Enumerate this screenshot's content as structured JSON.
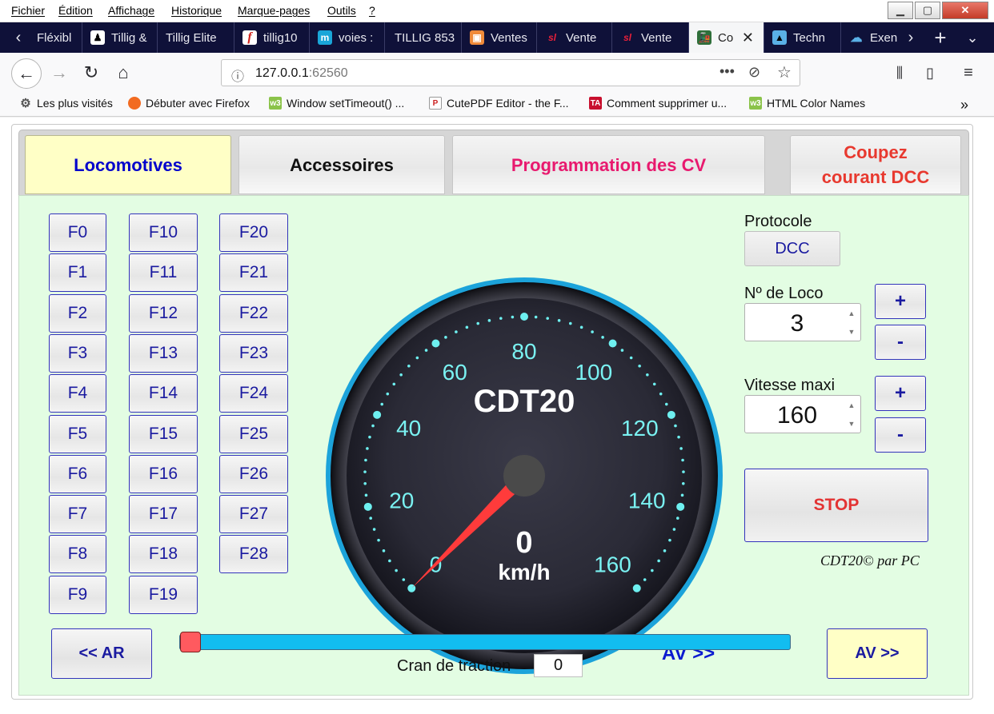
{
  "menu": [
    "Fichier",
    "Édition",
    "Affichage",
    "Historique",
    "Marque-pages",
    "Outils",
    "?"
  ],
  "tabs": [
    {
      "label": "Fléxibl",
      "icon": "none"
    },
    {
      "label": "Tillig &",
      "icon": "person-icon"
    },
    {
      "label": "Tillig Elite",
      "icon": "none"
    },
    {
      "label": "tillig10",
      "icon": "f-logo-icon"
    },
    {
      "label": "voies :",
      "icon": "m-logo-icon"
    },
    {
      "label": "TILLIG 853",
      "icon": "none"
    },
    {
      "label": "Ventes",
      "icon": "box-icon"
    },
    {
      "label": "Vente",
      "icon": "sl-logo-icon"
    },
    {
      "label": "Vente",
      "icon": "sl-logo-icon"
    },
    {
      "label": "Co",
      "icon": "train-icon"
    },
    {
      "label": "Techn",
      "icon": "techno-icon"
    },
    {
      "label": "Exen",
      "icon": "cloud-icon"
    }
  ],
  "url": {
    "host": "127.0.0.1",
    "port": ":62560"
  },
  "bookmarks": [
    "Les plus visités",
    "Débuter avec Firefox",
    "Window setTimeout() ...",
    "CutePDF Editor - the F...",
    "Comment supprimer u...",
    "HTML Color Names"
  ],
  "app": {
    "tabs": {
      "locomotives": "Locomotives",
      "accessoires": "Accessoires",
      "programmation": "Programmation des CV",
      "coupez_1": "Coupez",
      "coupez_2": "courant DCC"
    },
    "function_buttons": [
      "F0",
      "F1",
      "F2",
      "F3",
      "F4",
      "F5",
      "F6",
      "F7",
      "F8",
      "F9",
      "F10",
      "F11",
      "F12",
      "F13",
      "F14",
      "F15",
      "F16",
      "F17",
      "F18",
      "F19",
      "F20",
      "F21",
      "F22",
      "F23",
      "F24",
      "F25",
      "F26",
      "F27",
      "F28"
    ],
    "protocole_label": "Protocole",
    "protocole_value": "DCC",
    "loco_label": "Nº de Loco",
    "loco_value": "3",
    "vmax_label": "Vitesse maxi",
    "vmax_value": "160",
    "plus": "+",
    "minus": "-",
    "stop": "STOP",
    "credit": "CDT20© par PC",
    "gauge": {
      "title": "CDT20",
      "speed": "0",
      "unit": "km/h",
      "max": 160,
      "ticks": [
        "0",
        "20",
        "40",
        "60",
        "80",
        "100",
        "120",
        "140",
        "160"
      ],
      "direction": "AV >>"
    },
    "ar_button": "<< AR",
    "av_button": "AV >>",
    "traction_label": "Cran de traction",
    "traction_value": "0",
    "slider_level": 0
  },
  "colors": {
    "accent_blue": "#0000cc",
    "stop_red": "#e33333",
    "coupez_red": "#e8392f",
    "prog_pink": "#e8196e",
    "panel_green": "#e3fde3",
    "slider_blue": "#12bdf0"
  }
}
